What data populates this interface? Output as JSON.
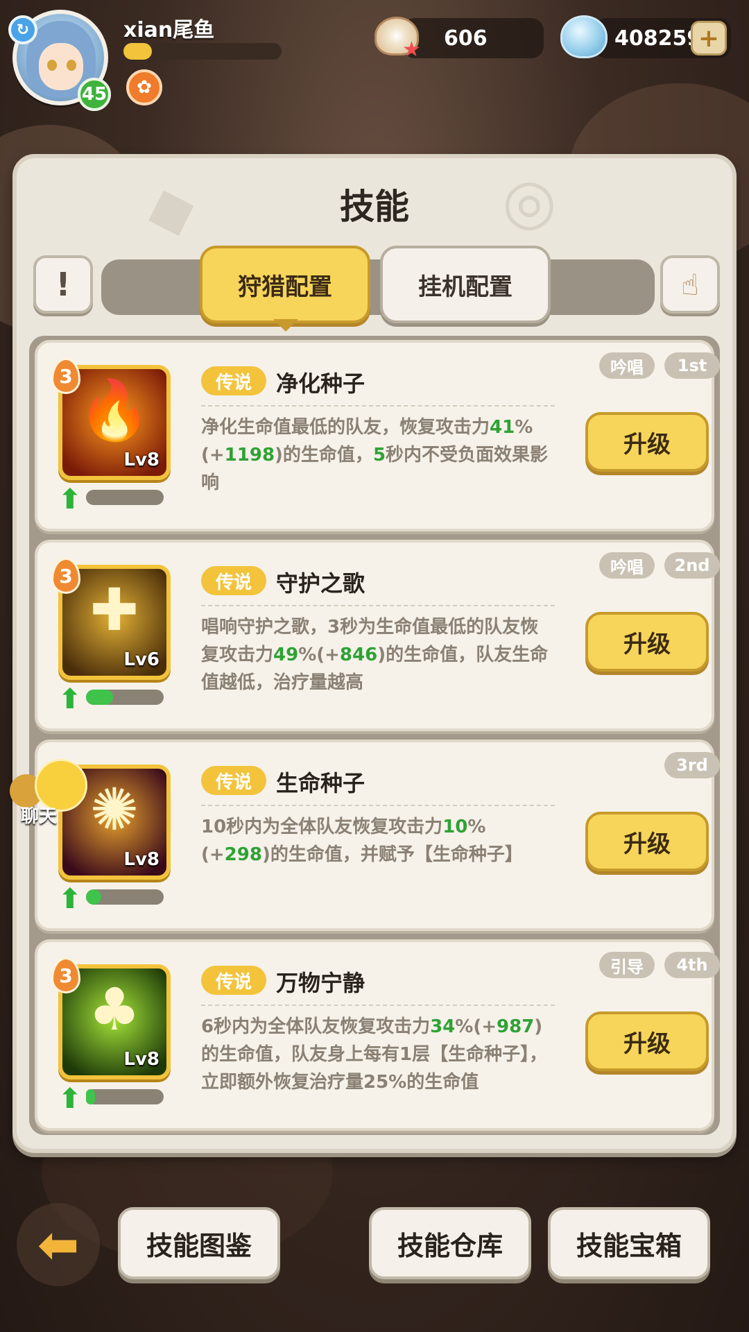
{
  "player": {
    "name": "xian尾鱼",
    "level": "45",
    "exp_fraction": 0.18
  },
  "currencies": {
    "pearl": "606",
    "gem": "408259"
  },
  "panel": {
    "title": "技能",
    "tabs": {
      "hunt": "狩猎配置",
      "idle": "挂机配置"
    },
    "info_icon": "!"
  },
  "skills": [
    {
      "rank": "3",
      "rarity": "传说",
      "name": "净化种子",
      "level": "Lv8",
      "type_tag": "吟唱",
      "order_tag": "1st",
      "desc_parts": [
        "净化生命值最低的队友，恢复攻击力",
        "41",
        "%(+",
        "1198",
        ")的生命值，",
        "5",
        "秒内不受负面效果影响"
      ],
      "progress": 0.0,
      "upgrade": "升级",
      "icon": "flame-drop-icon",
      "icon_colors": [
        "#ff9a1f",
        "#7a1a08"
      ]
    },
    {
      "rank": "3",
      "rarity": "传说",
      "name": "守护之歌",
      "level": "Lv6",
      "type_tag": "吟唱",
      "order_tag": "2nd",
      "desc_parts": [
        "唱响守护之歌，3秒为生命值最低的队友恢复攻击力",
        "49",
        "%(+",
        "846",
        ")的生命值，队友生命值越低，治疗量越高",
        "",
        ""
      ],
      "progress": 0.35,
      "upgrade": "升级",
      "icon": "holy-shield-icon",
      "icon_colors": [
        "#e3b136",
        "#4a2e0a"
      ]
    },
    {
      "rank": "",
      "rarity": "传说",
      "name": "生命种子",
      "level": "Lv8",
      "type_tag": "",
      "order_tag": "3rd",
      "desc_parts": [
        "10秒内为全体队友恢复攻击力",
        "10",
        "%(+",
        "298",
        ")的生命值，并赋予【生命种子】",
        "",
        ""
      ],
      "progress": 0.2,
      "upgrade": "升级",
      "icon": "life-seed-icon",
      "icon_colors": [
        "#e8a22e",
        "#3a0a1a"
      ]
    },
    {
      "rank": "3",
      "rarity": "传说",
      "name": "万物宁静",
      "level": "Lv8",
      "type_tag": "引导",
      "order_tag": "4th",
      "desc_parts": [
        "6秒内为全体队友恢复攻击力",
        "34",
        "%(+",
        "987",
        ")的生命值，队友身上每有1层【生命种子】，立即额外恢复治疗量25%的生命值",
        "",
        ""
      ],
      "progress": 0.12,
      "upgrade": "升级",
      "icon": "clover-icon",
      "icon_colors": [
        "#a6e63a",
        "#1e3a08"
      ]
    }
  ],
  "chat": {
    "label": "聊天"
  },
  "bottom": {
    "codex": "技能图鉴",
    "storage": "技能仓库",
    "chest": "技能宝箱"
  },
  "colors": {
    "accent_yellow": "#f7d55a",
    "highlight_green": "#2fa236",
    "panel_bg": "#ebe6dc"
  }
}
